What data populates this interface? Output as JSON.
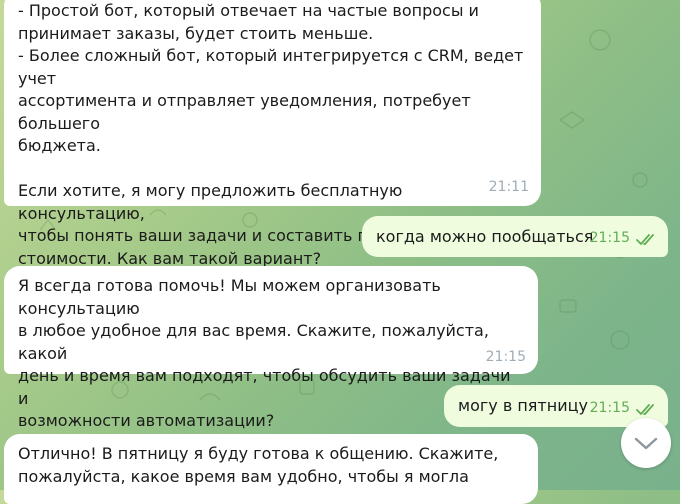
{
  "messages": [
    {
      "direction": "incoming",
      "text": "- Простой бот, который отвечает на частые вопросы и\nпринимает заказы, будет стоить меньше.\n- Более сложный бот, который интегрируется с CRM, ведет учет\nассортимента и отправляет уведомления, потребует большего\nбюджета.\n\nЕсли хотите, я могу предложить бесплатную консультацию,\nчтобы понять ваши задачи и составить примерный расчет\nстоимости. Как вам такой вариант?",
      "time": "21:11"
    },
    {
      "direction": "outgoing",
      "text": "когда можно пообщаться",
      "time": "21:15",
      "status": "read"
    },
    {
      "direction": "incoming",
      "text": "Я всегда готова помочь! Мы можем организовать консультацию\nв любое удобное для вас время. Скажите, пожалуйста, какой\nдень и время вам подходят, чтобы обсудить ваши задачи и\nвозможности автоматизации?",
      "time": "21:15"
    },
    {
      "direction": "outgoing",
      "text": "могу в пятницу",
      "time": "21:15",
      "status": "read"
    },
    {
      "direction": "incoming",
      "text": "Отлично! В пятницу я буду готова к общению. Скажите,\nпожалуйста, какое время вам удобно, чтобы я могла"
    }
  ],
  "icons": {
    "read_receipt": "double-check-icon",
    "scroll_down": "chevron-down-icon"
  },
  "colors": {
    "incoming_bubble": "#ffffff",
    "outgoing_bubble": "#effdde",
    "outgoing_time": "#62ac55",
    "incoming_time": "#a0acb6"
  }
}
